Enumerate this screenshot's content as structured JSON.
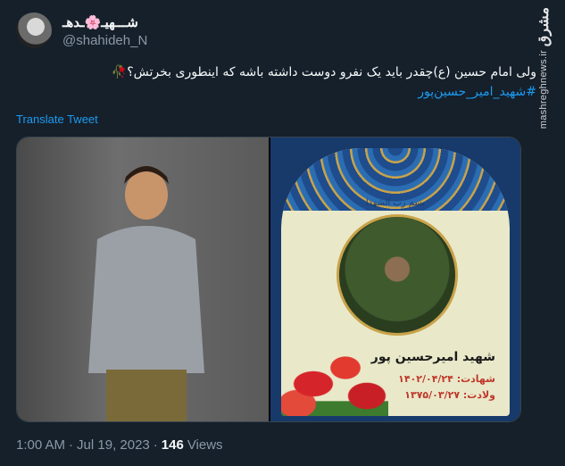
{
  "author": {
    "display_name": "شـــهیـ🌸ـدهـ",
    "handle": "@shahideh_N"
  },
  "watermark": {
    "logo": "مشرق",
    "site": "mashreghnews.ir"
  },
  "tweet": {
    "text": "ولی امام حسین (ع)چقدر باید یک نفرو دوست داشته باشه که اینطوری بخرتش؟🥀",
    "hashtag": "#شهید_امیر_حسین‌پور"
  },
  "translate_label": "Translate Tweet",
  "poster": {
    "basmala": "بسم رب الشهدا",
    "name": "شهید امیرحسین پور",
    "martyrdom_label": "شهادت: ۱۴۰۲/۰۴/۲۴",
    "birth_label": "ولادت: ۱۳۷۵/۰۳/۲۷"
  },
  "meta": {
    "time": "1:00 AM",
    "separator1": "·",
    "date": "Jul 19, 2023",
    "separator2": "·",
    "views_count": "146",
    "views_label": "Views"
  }
}
